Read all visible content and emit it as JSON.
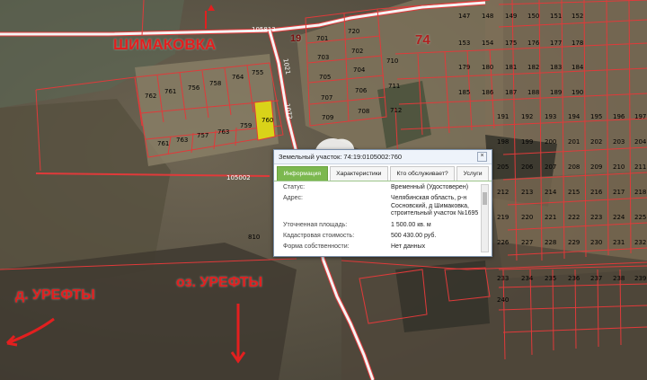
{
  "map": {
    "village_label": "ШИМАКОВКА",
    "region_number": "74",
    "area_19": "19",
    "road_labels": [
      "105813",
      "105002",
      "1021",
      "1072"
    ],
    "bottom_left_label": "д. УРЕФТЫ",
    "bottom_center_label": "оз. УРЕФТЫ",
    "highlight_lot": "760",
    "lots_left": [
      "762",
      "761",
      "756",
      "757",
      "758",
      "764",
      "763",
      "755",
      "759",
      "763",
      "760",
      "761",
      "810"
    ],
    "lots_upper_mid": [
      "720",
      "701",
      "702",
      "703",
      "704",
      "705",
      "706",
      "707",
      "708",
      "709",
      "710",
      "711",
      "712"
    ],
    "lots_right": [
      "147",
      "148",
      "149",
      "150",
      "151",
      "152",
      "153",
      "154",
      "175",
      "176",
      "177",
      "178",
      "179",
      "180",
      "181",
      "182",
      "183",
      "184",
      "185",
      "186",
      "187",
      "188",
      "189",
      "190",
      "191",
      "192",
      "193",
      "194",
      "195",
      "196",
      "197",
      "198",
      "199",
      "200",
      "201",
      "202",
      "203",
      "204",
      "205",
      "206",
      "207",
      "208",
      "209",
      "210",
      "211",
      "212",
      "213",
      "214",
      "215",
      "216",
      "217",
      "218",
      "219",
      "220",
      "221",
      "222",
      "223",
      "224",
      "225",
      "226",
      "227",
      "228",
      "229",
      "230",
      "231",
      "232",
      "233",
      "234",
      "235",
      "236",
      "237",
      "238",
      "239",
      "240"
    ],
    "colors": {
      "boundary": "#e03a3a",
      "road": "#f2f2f2",
      "highlight_fill": "#d9d319",
      "overlay_text": "#e21f1f"
    }
  },
  "popup": {
    "title": "Земельный участок: 74:19:0105002:760",
    "close_icon": "close-icon",
    "tabs": [
      "Информация",
      "Характеристики",
      "Кто обслуживает?",
      "Услуги"
    ],
    "rows": [
      {
        "label": "Статус:",
        "value": "Временный (Удостоверен)"
      },
      {
        "label": "Адрес:",
        "value": "Челябинская область, р-н Сосновский, д Шимаковка, строительный участок №1695"
      },
      {
        "label": "Уточненная площадь:",
        "value": "1 500.00 кв. м"
      },
      {
        "label": "Кадастровая стоимость:",
        "value": "500 430.00 руб."
      },
      {
        "label": "Форма собственности:",
        "value": "Нет данных"
      }
    ]
  }
}
